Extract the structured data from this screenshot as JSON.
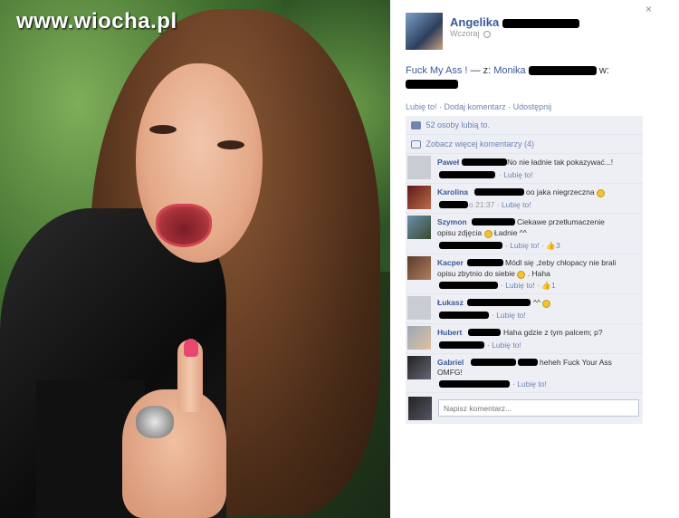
{
  "watermark": "www.wiocha.pl",
  "post": {
    "author": "Angelika",
    "time": "Wczoraj",
    "caption_title": "Fuck My Ass !",
    "caption_with": "— z:",
    "caption_person": "Monika",
    "caption_at": "w:",
    "actions": [
      "Lubię to!",
      "Dodaj komentarz",
      "Udostępnij"
    ],
    "likes": "52 osoby lubią to.",
    "more_comments": "Zobacz więcej komentarzy (4)"
  },
  "comments": [
    {
      "name": "Paweł",
      "text": "No nie ładnie tak pokazywać...!",
      "meta": "Lubię to!"
    },
    {
      "name": "Karolina",
      "text": "oo jaka niegrzeczna",
      "time": "21:37",
      "meta": "Lubię to!"
    },
    {
      "name": "Szymon",
      "text": "Ciekawe przetłumaczenie",
      "text2": "opisu zdjęcia",
      "text3": "Ładnie ^^",
      "meta": "Lubię to!",
      "likes": "3"
    },
    {
      "name": "Kacper",
      "text": "Módl się ,żeby chłopacy nie brali",
      "text2": "opisu zbytnio do siebie",
      "text3": ". Haha",
      "meta": "Lubię to!",
      "likes": "1"
    },
    {
      "name": "Łukasz",
      "text": "^^",
      "meta": "Lubię to!"
    },
    {
      "name": "Hubert",
      "text": "Haha gdzie z tym palcem; p?",
      "meta": "Lubię to!"
    },
    {
      "name": "Gabriel",
      "text": "heheh Fuck Your Ass",
      "text2": "OMFG!",
      "meta": "Lubię to!"
    }
  ],
  "reply_placeholder": "Napisz komentarz...",
  "close_label": "×",
  "colors": {
    "link": "#3b5998",
    "meta": "#6d84b4",
    "ufi_bg": "#edeff4"
  }
}
